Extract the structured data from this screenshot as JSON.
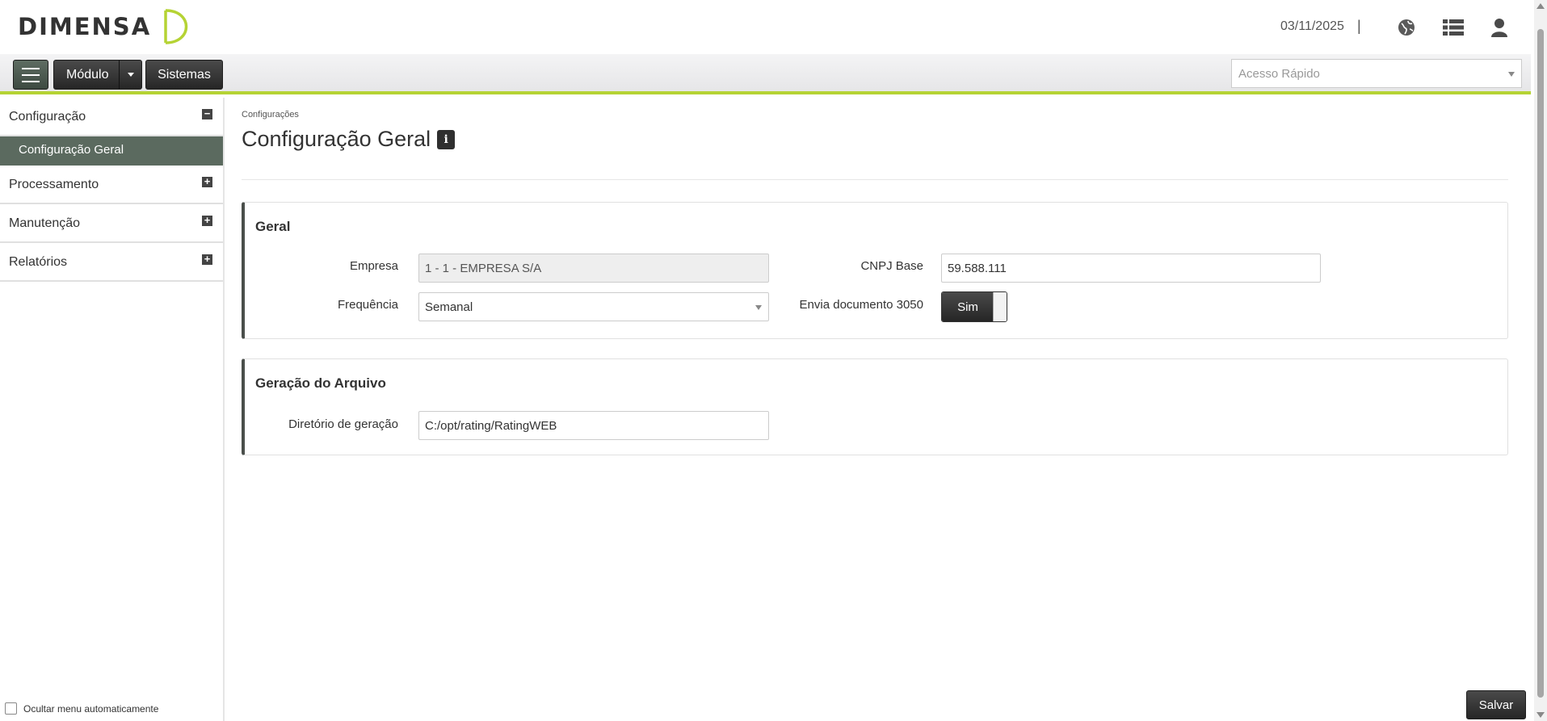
{
  "header": {
    "brand": "DIMENSA",
    "date": "03/11/2025",
    "separator": "|",
    "icons": [
      "globe-icon",
      "list-icon",
      "user-icon"
    ]
  },
  "toolbar": {
    "module_label": "Módulo",
    "systems_label": "Sistemas",
    "quick_access_placeholder": "Acesso Rápido"
  },
  "sidebar": {
    "sections": [
      {
        "label": "Configuração",
        "expanded": true,
        "toggle": "−",
        "items": [
          {
            "label": "Configuração Geral",
            "active": true
          }
        ]
      },
      {
        "label": "Processamento",
        "expanded": false,
        "toggle": "+"
      },
      {
        "label": "Manutenção",
        "expanded": false,
        "toggle": "+"
      },
      {
        "label": "Relatórios",
        "expanded": false,
        "toggle": "+"
      }
    ],
    "footer_checkbox_label": "Ocultar menu automaticamente"
  },
  "main": {
    "breadcrumb": "Configurações",
    "title": "Configuração Geral",
    "info_glyph": "i",
    "panels": [
      {
        "title": "Geral",
        "fields": {
          "empresa_label": "Empresa",
          "empresa_value": "1 - 1 - EMPRESA S/A",
          "frequencia_label": "Frequência",
          "frequencia_value": "Semanal",
          "cnpj_label": "CNPJ Base",
          "cnpj_value": "59.588.111",
          "envia_label": "Envia documento 3050",
          "envia_value": "Sim"
        }
      },
      {
        "title": "Geração do Arquivo",
        "fields": {
          "diretorio_label": "Diretório de geração",
          "diretorio_value": "C:/opt/rating/RatingWEB"
        }
      }
    ],
    "save_label": "Salvar"
  },
  "colors": {
    "accent": "#b5d334",
    "sidebar_active": "#5b6a5f",
    "button_dark": "#2f2f2f"
  }
}
